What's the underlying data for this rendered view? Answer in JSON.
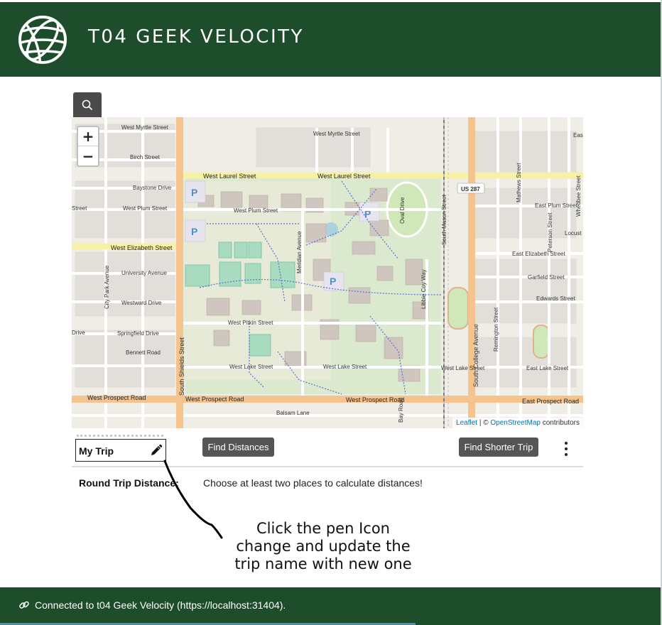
{
  "app": {
    "title": "T04 GEEK VELOCITY",
    "logo_icon": "globe-icon",
    "accent_color": "#1e4d2b",
    "button_color": "#555555"
  },
  "search": {
    "icon": "search-icon"
  },
  "map": {
    "zoom_in": "+",
    "zoom_out": "−",
    "attribution": {
      "leaflet": "Leaflet",
      "separator": " | © ",
      "osm": "OpenStreetMap",
      "suffix": " contributors"
    },
    "labels": {
      "w_myrtle_1": "West Myrtle Street",
      "w_myrtle_2": "West Myrtle Street",
      "birch": "Birch Street",
      "w_laurel_1": "West Laurel Street",
      "w_laurel_2": "West Laurel Street",
      "baystone": "Baystone Drive",
      "w_plum_1": "West Plum Street",
      "w_plum_2": "West Plum Street",
      "e_plum": "East Plum Street",
      "w_elizabeth": "West Elizabeth Street",
      "e_elizabeth": "East Elizabeth Street",
      "university": "University Avenue",
      "westward": "Westward Drive",
      "springfield": "Springfield Drive",
      "bennett": "Bennett Road",
      "w_pitkin": "West Pitkin Street",
      "w_lake_1": "West Lake Street",
      "w_lake_2": "West Lake Street",
      "w_lake_3": "West Lake Street",
      "e_lake": "East Lake Street",
      "w_prospect_1": "West Prospect Road",
      "w_prospect_2": "West Prospect Road",
      "w_prospect_3": "West Prospect Road",
      "e_prospect": "East Prospect Road",
      "balsam": "Balsam Lane",
      "garfield": "Garfield Street",
      "edwards": "Edwards Street",
      "locust": "Locust",
      "us287": "US 287",
      "s_shields": "South Shields Street",
      "s_college": "South College Avenue",
      "s_mason": "South Mason Street",
      "meridian": "Meridian Avenue",
      "city_park": "City Park Avenue",
      "mathews": "Mathews Street",
      "remington": "Remington Street",
      "whedbee": "Whedbee Street",
      "peterson": "Peterson Street",
      "oval": "Oval Drive",
      "libbie": "Libbie Coy Way",
      "street": "Street",
      "drive": "Drive",
      "east": "East",
      "bay_road": "Bay Road"
    }
  },
  "trip": {
    "name": "My Trip",
    "edit_icon": "pencil-icon",
    "find_distances": "Find Distances",
    "find_shorter": "Find Shorter Trip",
    "menu_icon": "more-vertical-icon",
    "round_trip_label": "Round Trip Distance:",
    "round_trip_message": "Choose at least two places to calculate distances!"
  },
  "annotation": {
    "line1": "Click the pen Icon",
    "line2": "change and update the",
    "line3": "trip name with new one"
  },
  "footer": {
    "link_icon": "link-icon",
    "status": "Connected to t04 Geek Velocity  (https://localhost:31404)."
  }
}
